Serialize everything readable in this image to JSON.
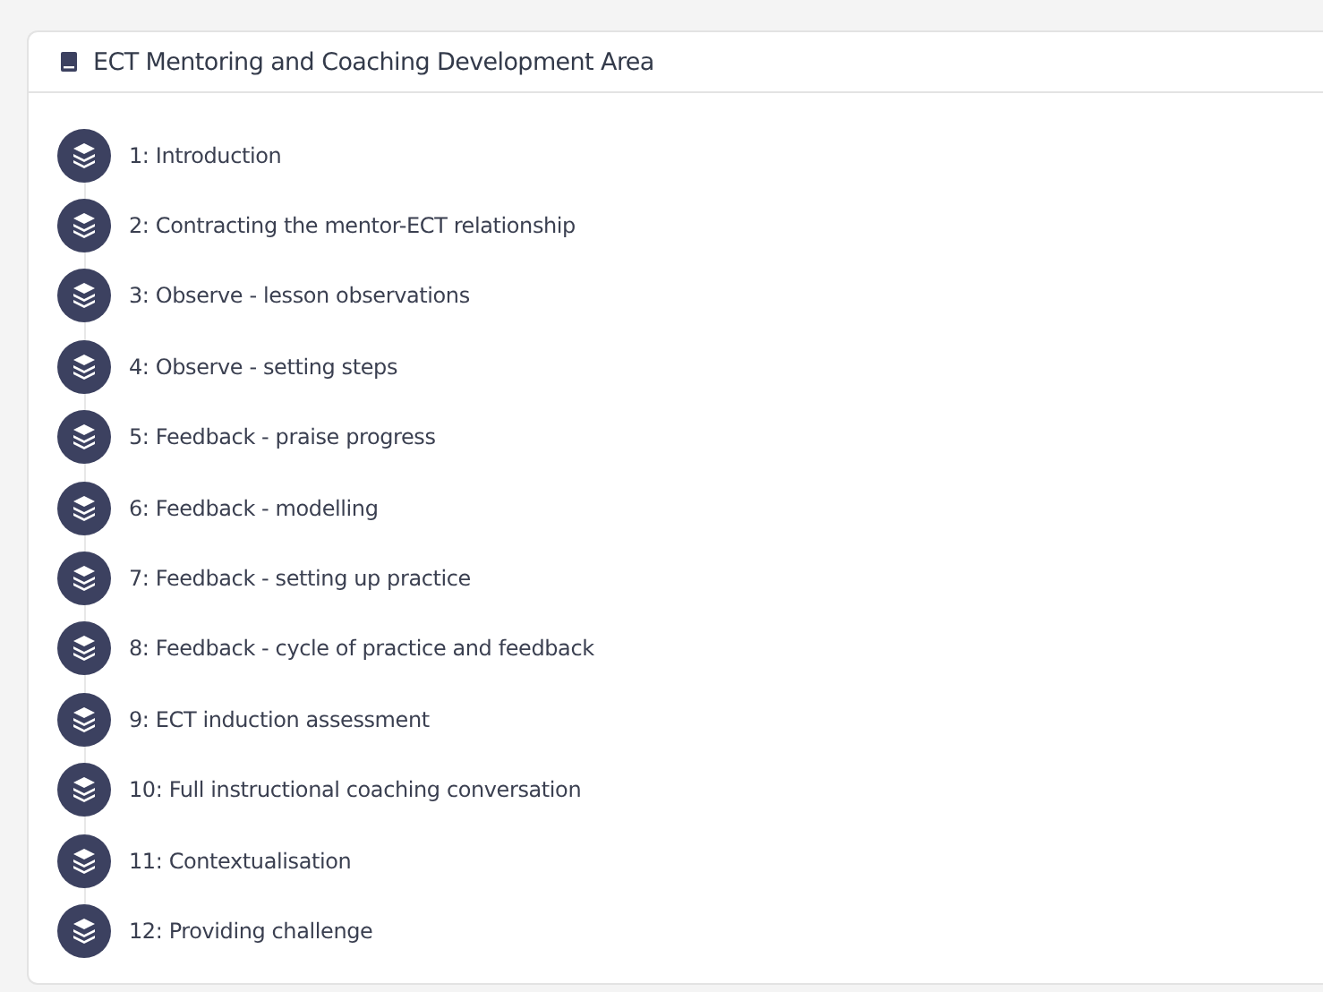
{
  "panel": {
    "title": "ECT Mentoring and Coaching Development Area"
  },
  "modules": [
    {
      "label": "1: Introduction"
    },
    {
      "label": "2: Contracting the mentor-ECT relationship"
    },
    {
      "label": "3: Observe - lesson observations"
    },
    {
      "label": "4: Observe - setting steps"
    },
    {
      "label": "5: Feedback - praise progress"
    },
    {
      "label": "6: Feedback - modelling"
    },
    {
      "label": "7: Feedback - setting up practice"
    },
    {
      "label": "8: Feedback - cycle of practice and feedback"
    },
    {
      "label": "9: ECT induction assessment"
    },
    {
      "label": "10: Full instructional coaching conversation"
    },
    {
      "label": "11: Contextualisation"
    },
    {
      "label": "12: Providing challenge"
    }
  ]
}
